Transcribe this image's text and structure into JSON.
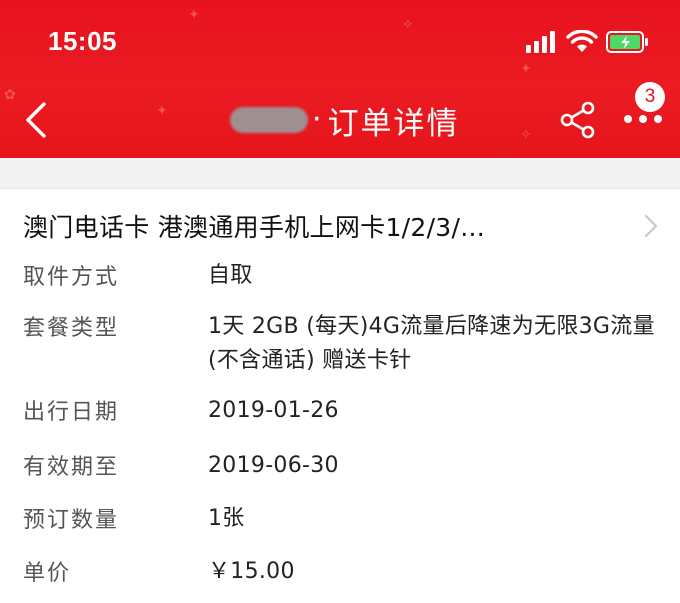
{
  "status_bar": {
    "time": "15:05"
  },
  "nav": {
    "back_icon": "chevron-left-icon",
    "title_separator": "·",
    "title": "订单详情",
    "share_icon": "share-icon",
    "more_icon": "more-icon",
    "badge_count": "3"
  },
  "product": {
    "name": "澳门电话卡 港澳通用手机上网卡1/2/3/...",
    "chevron_icon": "chevron-right-icon"
  },
  "details": [
    {
      "label": "取件方式",
      "value": "自取"
    },
    {
      "label": "套餐类型",
      "value": "1天 2GB (每天)4G流量后降速为无限3G流量(不含通话) 赠送卡针"
    },
    {
      "label": "出行日期",
      "value": "2019-01-26"
    },
    {
      "label": "有效期至",
      "value": "2019-06-30"
    },
    {
      "label": "预订数量",
      "value": "1张"
    },
    {
      "label": "单价",
      "value": "￥15.00"
    }
  ],
  "colors": {
    "header_red": "#e8121e",
    "battery_green": "#4cd964",
    "background": "#ffffff",
    "band_gray": "#f3f3f3"
  }
}
